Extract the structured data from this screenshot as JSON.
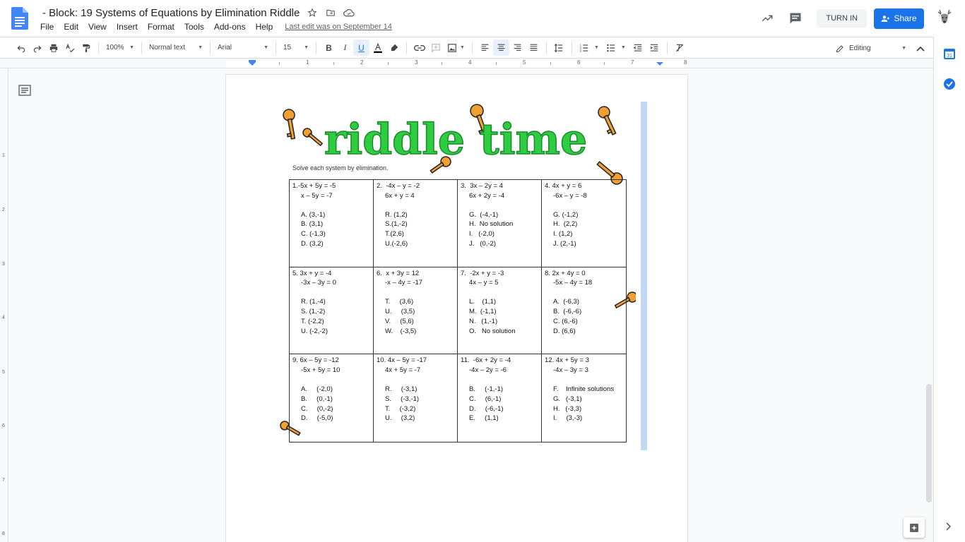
{
  "header": {
    "title": "- Block: 19 Systems of Equations by Elimination Riddle",
    "menu": [
      "File",
      "Edit",
      "View",
      "Insert",
      "Format",
      "Tools",
      "Add-ons",
      "Help"
    ],
    "last_edit": "Last edit was on September 14",
    "turn_in": "TURN IN",
    "share": "Share"
  },
  "toolbar": {
    "zoom": "100%",
    "style": "Normal text",
    "font": "Arial",
    "size": "15",
    "mode": "Editing"
  },
  "ruler": {
    "numbers": [
      "1",
      "2",
      "3",
      "4",
      "5",
      "6",
      "7",
      "8"
    ]
  },
  "vruler": {
    "numbers": [
      "1",
      "2",
      "3",
      "4",
      "5",
      "6",
      "7",
      "8"
    ]
  },
  "worksheet": {
    "title": "riddle time",
    "instructions": "Solve each system by elimination.",
    "problems": [
      {
        "eq1": "1.-5x + 5y = -5",
        "eq2": "x – 5y = -7",
        "options": [
          "A. (3,-1)",
          "B. (3,1)",
          "C. (-1,3)",
          "D. (3,2)"
        ]
      },
      {
        "eq1": "2.  -4x – y = -2",
        "eq2": "6x + y = 4",
        "options": [
          "R. (1,2)",
          "S.(1,-2)",
          "T.(2,6)",
          "U.(-2,6)"
        ]
      },
      {
        "eq1": "3.  3x – 2y = 4",
        "eq2": "6x + 2y = -4",
        "options": [
          "G.  (-4,-1)",
          "H.  No solution",
          "I.   (-2,0)",
          "J.   (0,-2)"
        ]
      },
      {
        "eq1": "4. 4x + y = 6",
        "eq2": "-6x – y = -8",
        "options": [
          "G. (-1,2)",
          "H.  (2,2)",
          "I. (1,2)",
          "J. (2,-1)"
        ]
      },
      {
        "eq1": "5. 3x + y = -4",
        "eq2": "-3x – 3y = 0",
        "options": [
          "R. (1,-4)",
          "S. (1,-2)",
          "T. (-2,2)",
          "U. (-2,-2)"
        ]
      },
      {
        "eq1": "6.  x + 3y = 12",
        "eq2": "-x – 4y = -17",
        "options": [
          "T.     (3,6)",
          "U.     (3,5)",
          "V.     (5,6)",
          "W.    (-3,5)"
        ]
      },
      {
        "eq1": "7.  -2x + y = -3",
        "eq2": "4x – y = 5",
        "options": [
          "L.    (1,1)",
          "M.  (-1,1)",
          "N.   (1,-1)",
          "O.   No solution"
        ]
      },
      {
        "eq1": "8. 2x + 4y = 0",
        "eq2": "-5x – 4y = 18",
        "options": [
          "A.  (-6,3)",
          "B.  (-6,-6)",
          "C. (6,-6)",
          "D. (6,6)"
        ]
      },
      {
        "eq1": "9. 6x – 5y = -12",
        "eq2": "-5x + 5y = 10",
        "options": [
          "A.     (-2,0)",
          "B.     (0,-1)",
          "C.     (0,-2)",
          "D.     (-5,0)"
        ]
      },
      {
        "eq1": "10. 4x – 5y = -17",
        "eq2": "4x + 5y = -7",
        "options": [
          "R.     (-3,1)",
          "S.     (-3,-1)",
          "T.     (-3,2)",
          "U.     (3,2)"
        ]
      },
      {
        "eq1": "11.  -6x + 2y = -4",
        "eq2": "-4x – 2y = -6",
        "options": [
          "B.     (-1,-1)",
          "C.     (6,-1)",
          "D.     (-6,-1)",
          "E.     (1,1)"
        ]
      },
      {
        "eq1": "12. 4x + 5y = 3",
        "eq2": "-4x – 3y = 3",
        "options": [
          "F.    Infinite solutions",
          "G.   (-3,1)",
          "H.   (-3,3)",
          "I.     (3,-3)"
        ]
      }
    ]
  },
  "colors": {
    "accent": "#1a73e8",
    "title_green": "#2ecc40",
    "key_orange": "#f0a030",
    "selection": "#c3d7f7"
  }
}
